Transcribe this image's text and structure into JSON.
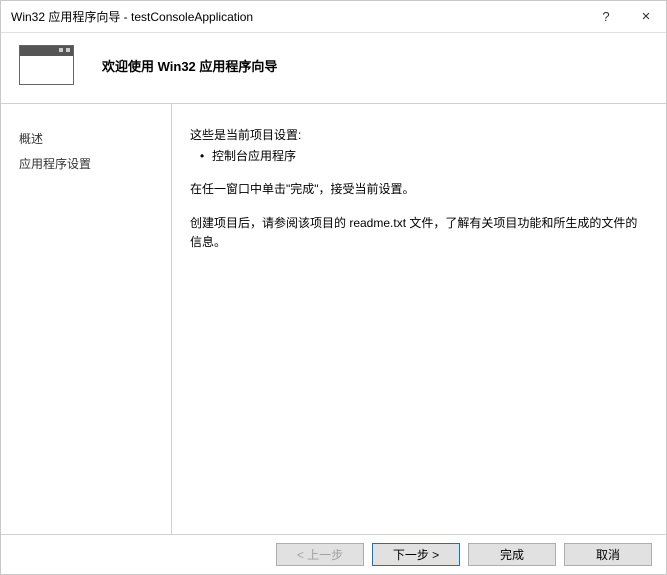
{
  "titlebar": {
    "text": "Win32 应用程序向导 - testConsoleApplication",
    "help": "?",
    "close": "×"
  },
  "header": {
    "title": "欢迎使用 Win32 应用程序向导"
  },
  "sidebar": {
    "items": [
      {
        "label": "概述"
      },
      {
        "label": "应用程序设置"
      }
    ]
  },
  "content": {
    "intro": "这些是当前项目设置:",
    "bullet": "控制台应用程序",
    "para1": "在任一窗口中单击\"完成\"，接受当前设置。",
    "para2": "创建项目后，请参阅该项目的 readme.txt 文件，了解有关项目功能和所生成的文件的信息。"
  },
  "footer": {
    "back": "< 上一步",
    "next": "下一步 >",
    "finish": "完成",
    "cancel": "取消"
  }
}
